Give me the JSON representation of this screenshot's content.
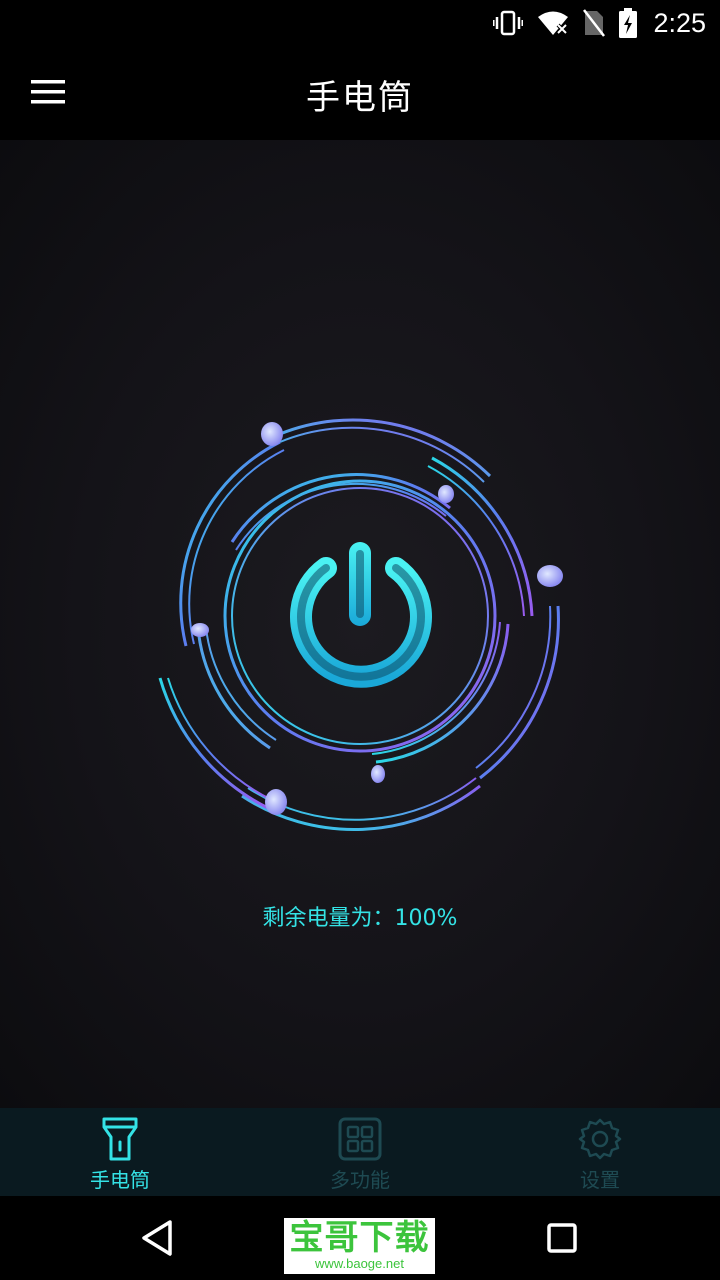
{
  "status_bar": {
    "time": "2:25",
    "icons": [
      "vibrate-icon",
      "wifi-icon",
      "no-sim-icon",
      "battery-charging-icon"
    ]
  },
  "app_bar": {
    "title": "手电筒",
    "menu_icon": "hamburger-menu-icon"
  },
  "main": {
    "power_button_icon": "power-icon",
    "battery_text": "剩余电量为：100%"
  },
  "tabs": [
    {
      "label": "手电筒",
      "icon": "flashlight-icon",
      "active": true
    },
    {
      "label": "多功能",
      "icon": "grid-icon",
      "active": false
    },
    {
      "label": "设置",
      "icon": "gear-icon",
      "active": false
    }
  ],
  "nav_bar": {
    "icons": [
      "back-triangle-icon",
      "recent-apps-square-icon"
    ]
  },
  "watermark": {
    "main": "宝哥下载",
    "sub": "www.baoge.net"
  },
  "colors": {
    "accent": "#34e3e6",
    "inactive": "#1e4a52",
    "tabbar_bg": "#0a1a20",
    "ring_purple": "#8a5cf0",
    "ring_cyan": "#2ad8e6"
  }
}
